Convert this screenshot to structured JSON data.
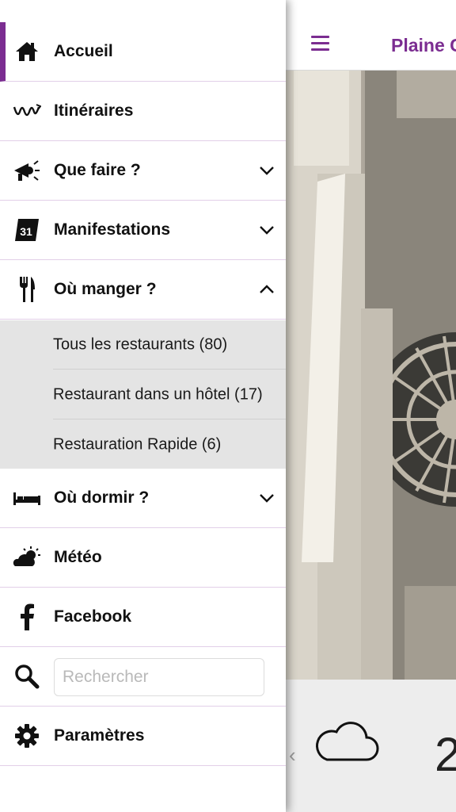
{
  "app": {
    "title": "Plaine C",
    "weather": {
      "prev_symbol": "‹",
      "temperature": "2"
    }
  },
  "drawer": {
    "items": [
      {
        "label": "Accueil",
        "icon": "home-icon",
        "active": true
      },
      {
        "label": "Itinéraires",
        "icon": "route-icon"
      },
      {
        "label": "Que faire ?",
        "icon": "megaphone-icon",
        "expandable": true
      },
      {
        "label": "Manifestations",
        "icon": "calendar-icon",
        "icon_text": "31",
        "expandable": true
      },
      {
        "label": "Où manger ?",
        "icon": "cutlery-icon",
        "expandable": true,
        "expanded": true
      },
      {
        "label": "Où dormir ?",
        "icon": "bed-icon",
        "expandable": true
      },
      {
        "label": "Météo",
        "icon": "weather-icon"
      },
      {
        "label": "Facebook",
        "icon": "facebook-icon"
      },
      {
        "label": "Paramètres",
        "icon": "gear-icon"
      }
    ],
    "submenu": [
      {
        "label": "Tous les restaurants (80)"
      },
      {
        "label": "Restaurant dans un hôtel (17)"
      },
      {
        "label": "Restauration Rapide (6)"
      }
    ],
    "search": {
      "placeholder": "Rechercher",
      "value": ""
    }
  },
  "colors": {
    "accent": "#7b2d91",
    "divider": "#e2cfe8",
    "submenu_bg": "#e4e4e4"
  }
}
